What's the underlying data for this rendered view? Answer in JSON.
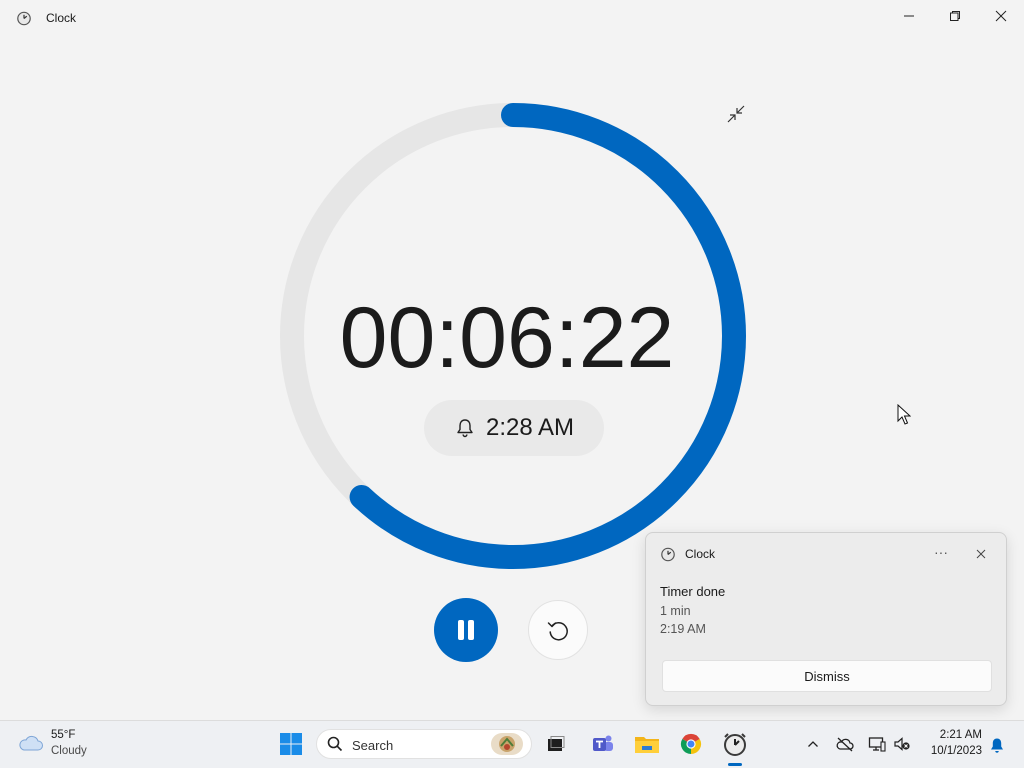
{
  "window": {
    "title": "Clock",
    "app_icon": "clock-app-icon",
    "controls": [
      "minimize-icon",
      "restore-icon",
      "close-icon"
    ]
  },
  "timer": {
    "remaining": "00:06:22",
    "alarm_time": "2:28 AM",
    "progress_fraction": 0.62,
    "accent_color": "#0067c0",
    "track_color": "#e6e6e6",
    "icons": [
      "bell-icon",
      "minimize-view-icon",
      "pause-icon",
      "reset-icon"
    ]
  },
  "notification": {
    "app_name": "Clock",
    "title": "Timer done",
    "duration": "1 min",
    "time": "2:19 AM",
    "dismiss_label": "Dismiss",
    "more_label": "···"
  },
  "taskbar": {
    "weather": {
      "temp": "55°F",
      "condition": "Cloudy"
    },
    "search_placeholder": "Search",
    "apps": [
      "start-icon",
      "task-view-icon",
      "teams-icon",
      "file-explorer-icon",
      "chrome-icon",
      "clock-taskbar-icon"
    ],
    "tray": [
      "chevron-up-icon",
      "onedrive-offline-icon",
      "network-icon",
      "volume-muted-icon"
    ],
    "clock": {
      "time": "2:21 AM",
      "date": "10/1/2023"
    }
  }
}
